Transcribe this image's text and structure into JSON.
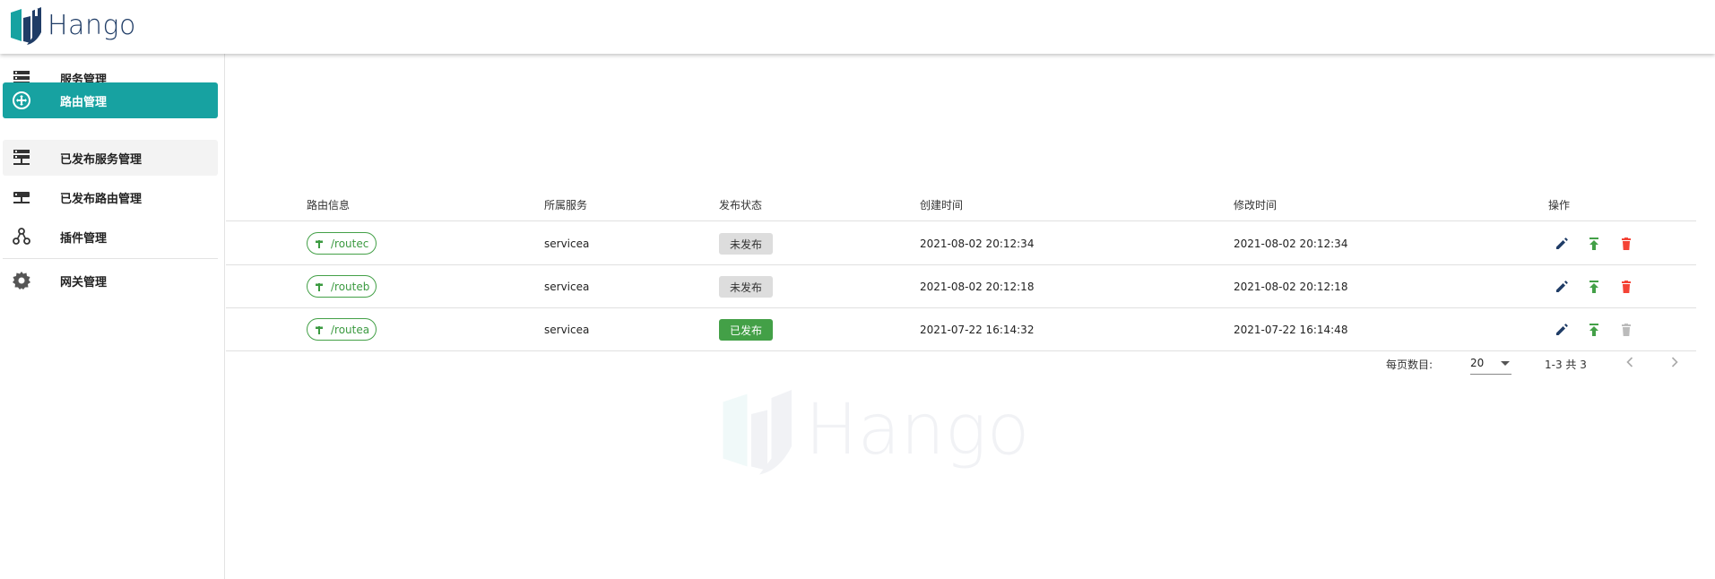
{
  "app": {
    "name": "Hango"
  },
  "sidebar": {
    "items": [
      {
        "label": "服务管理",
        "icon": "server-icon"
      },
      {
        "label": "路由管理",
        "icon": "route-hub-icon",
        "active": true
      },
      {
        "label": "已发布服务管理",
        "icon": "published-server-icon"
      },
      {
        "label": "已发布路由管理",
        "icon": "published-route-icon"
      },
      {
        "label": "插件管理",
        "icon": "plugin-icon"
      },
      {
        "label": "网关管理",
        "icon": "gear-icon"
      }
    ]
  },
  "table": {
    "headers": {
      "route": "路由信息",
      "service": "所属服务",
      "status": "发布状态",
      "created": "创建时间",
      "modified": "修改时间",
      "actions": "操作"
    },
    "rows": [
      {
        "route": "/routec",
        "service": "servicea",
        "status": "未发布",
        "published": false,
        "created": "2021-08-02 20:12:34",
        "modified": "2021-08-02 20:12:34"
      },
      {
        "route": "/routeb",
        "service": "servicea",
        "status": "未发布",
        "published": false,
        "created": "2021-08-02 20:12:18",
        "modified": "2021-08-02 20:12:18"
      },
      {
        "route": "/routea",
        "service": "servicea",
        "status": "已发布",
        "published": true,
        "created": "2021-07-22 16:14:32",
        "modified": "2021-07-22 16:14:48"
      }
    ]
  },
  "pagination": {
    "rows_per_page_label": "每页数目:",
    "rows_per_page": "20",
    "range": "1-3 共 3"
  },
  "colors": {
    "accent": "#17a2a1",
    "published": "#43a047",
    "delete": "#f44336",
    "edit": "#1f3c66"
  }
}
